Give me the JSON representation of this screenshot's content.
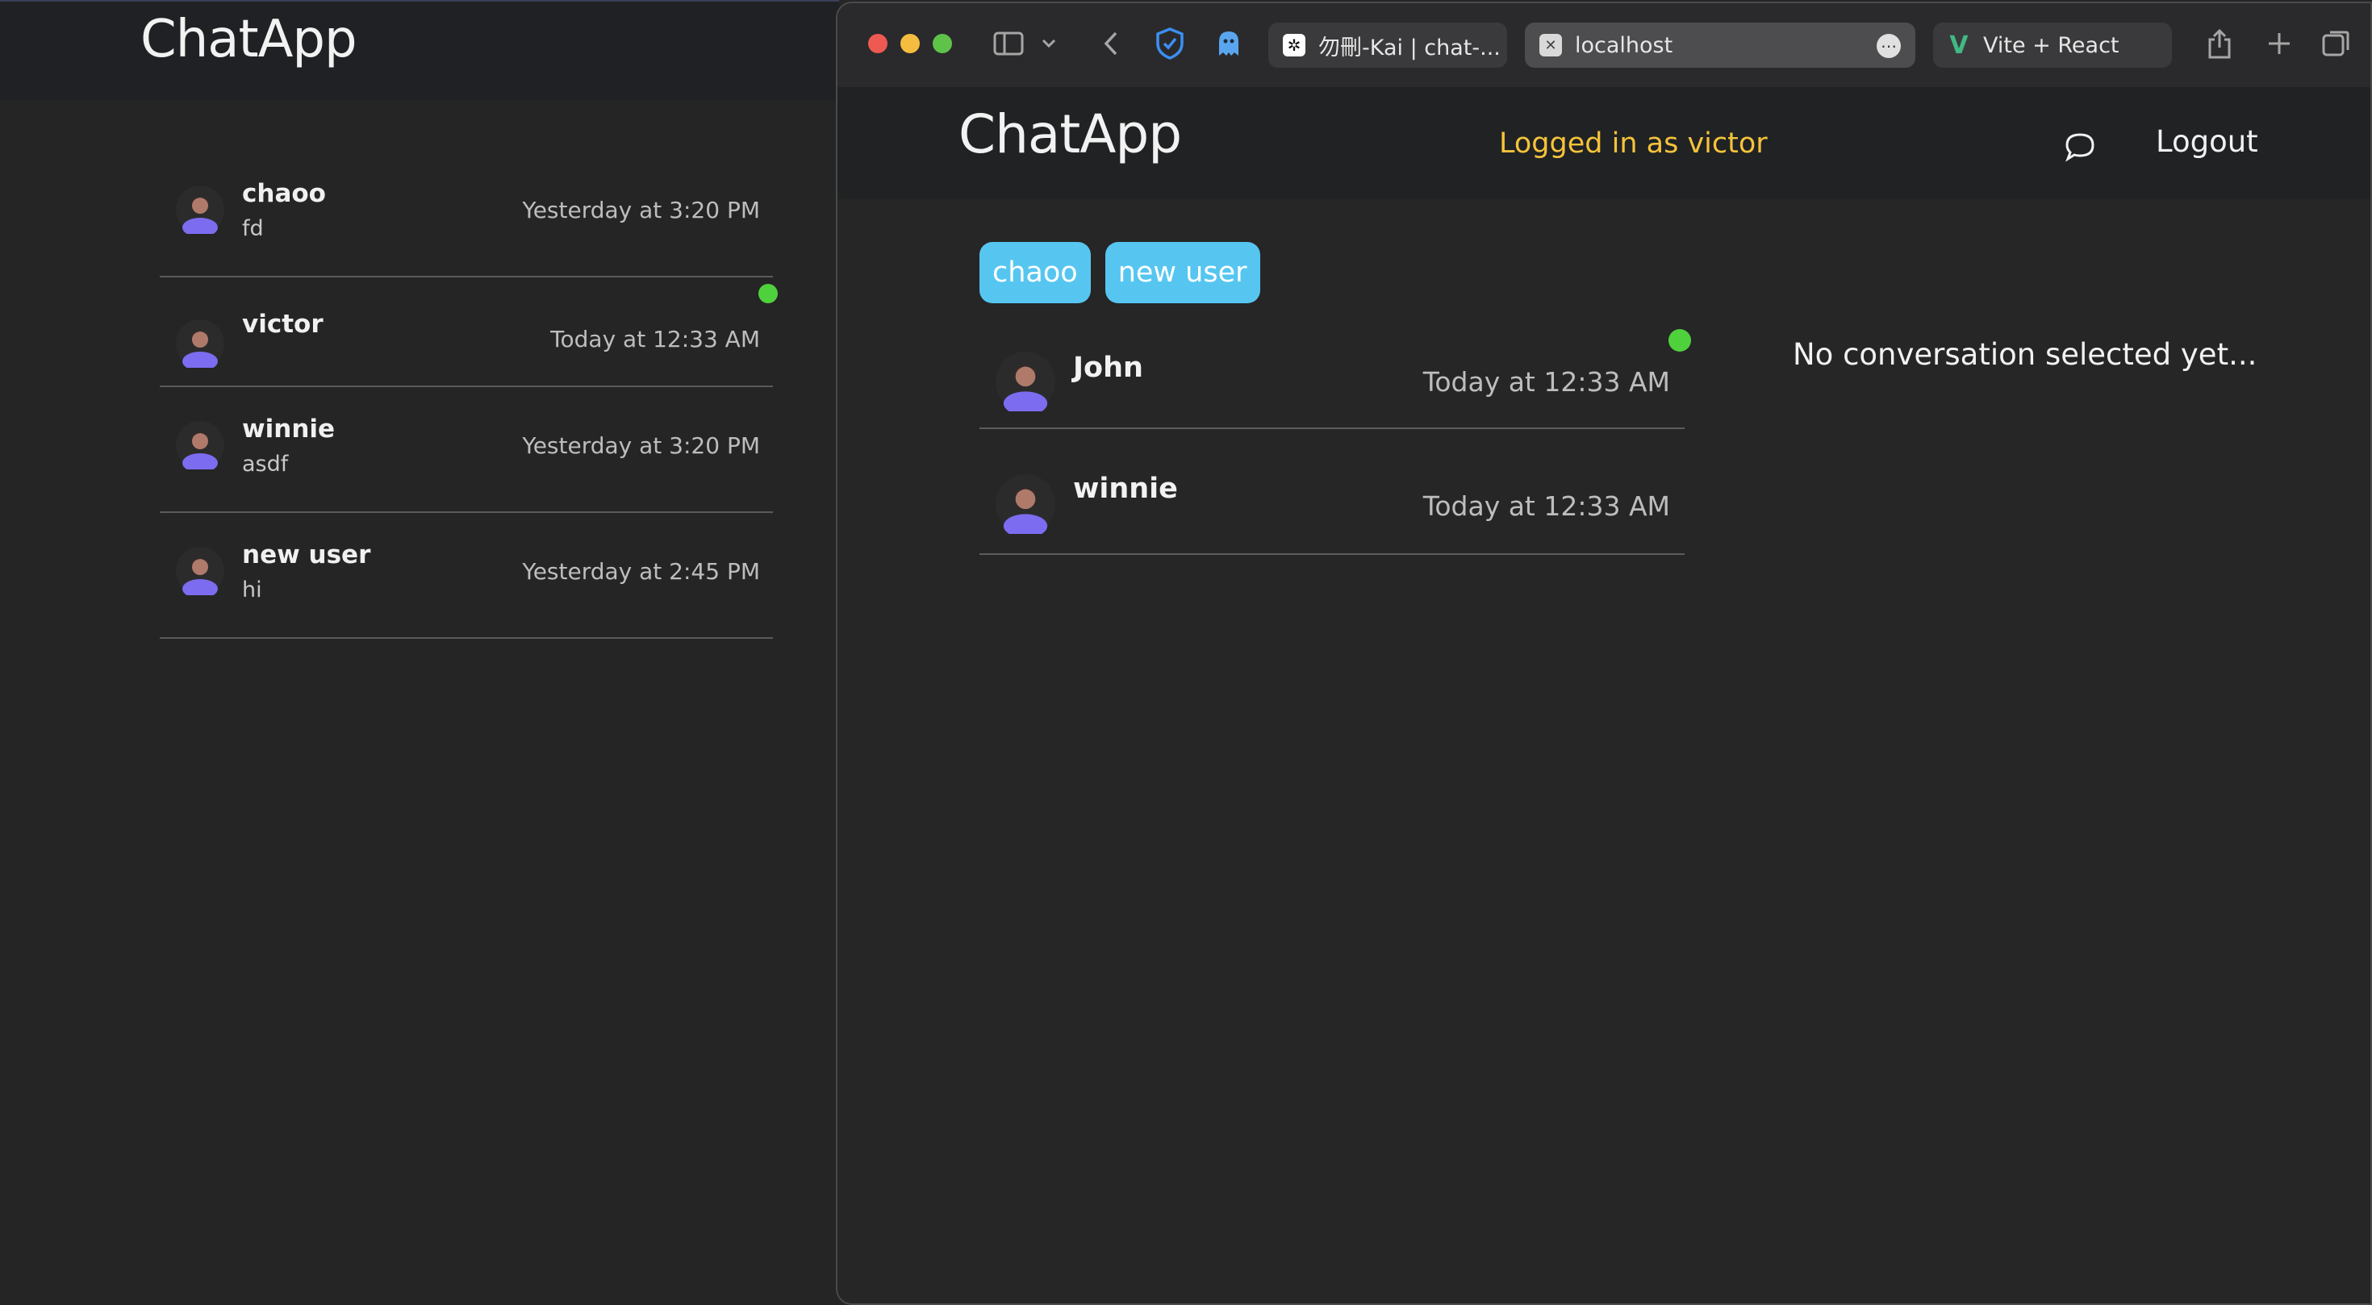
{
  "background_app": {
    "title": "ChatApp",
    "conversations": [
      {
        "name": "chaoo",
        "preview": "fd",
        "time": "Yesterday at 3:20 PM",
        "online": false
      },
      {
        "name": "victor",
        "preview": "",
        "time": "Today at 12:33 AM",
        "online": true
      },
      {
        "name": "winnie",
        "preview": "asdf",
        "time": "Yesterday at 3:20 PM",
        "online": false
      },
      {
        "name": "new user",
        "preview": "hi",
        "time": "Yesterday at 2:45 PM",
        "online": false
      }
    ]
  },
  "browser": {
    "tabs": [
      {
        "label": "勿刪-Kai | chat-...",
        "icon": "openai-icon"
      },
      {
        "label": "localhost",
        "icon": "close-icon",
        "active": true
      },
      {
        "label": "Vite + React",
        "icon": "vue-icon"
      }
    ]
  },
  "app": {
    "title": "ChatApp",
    "login_status": "Logged in as victor",
    "logout_label": "Logout",
    "chips": [
      "chaoo",
      "new user"
    ],
    "conversations": [
      {
        "name": "John",
        "time": "Today at 12:33 AM",
        "online": true
      },
      {
        "name": "winnie",
        "time": "Today at 12:33 AM",
        "online": false
      }
    ],
    "empty_state": "No conversation selected yet..."
  },
  "colors": {
    "accent_chip": "#56c6f0",
    "login_status": "#f5c33b",
    "online": "#4fd13d",
    "avatar": "#7b6cf0"
  }
}
